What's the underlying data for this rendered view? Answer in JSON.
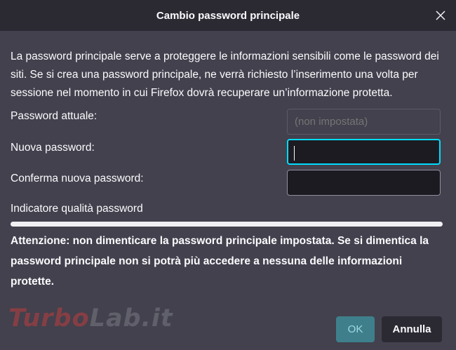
{
  "dialog": {
    "title": "Cambio password principale",
    "close_icon": "close-icon",
    "description": "La password principale serve a proteggere le informazioni sensibili come le password dei siti. Se si crea una password principale, ne verrà richiesto l’inserimento una volta per sessione nel momento in cui Firefox dovrà recuperare un’informazione protetta.",
    "current_password": {
      "label": "Password attuale:",
      "placeholder": "(non impostata)",
      "value": ""
    },
    "new_password": {
      "label": "Nuova password:",
      "value": ""
    },
    "confirm_password": {
      "label": "Conferma nuova password:",
      "value": ""
    },
    "quality": {
      "label": "Indicatore qualità password",
      "level": 0
    },
    "warning": "Attenzione: non dimenticare la password principale impostata. Se si dimentica la password principale non si potrà più accedere a nessuna delle informazioni protette.",
    "ok_label": "OK",
    "cancel_label": "Annulla"
  },
  "watermark": {
    "part1": "Turbo",
    "part2": "Lab.it"
  },
  "colors": {
    "accent": "#00ddff",
    "background": "#42414d",
    "titlebar": "#2b2a33"
  }
}
